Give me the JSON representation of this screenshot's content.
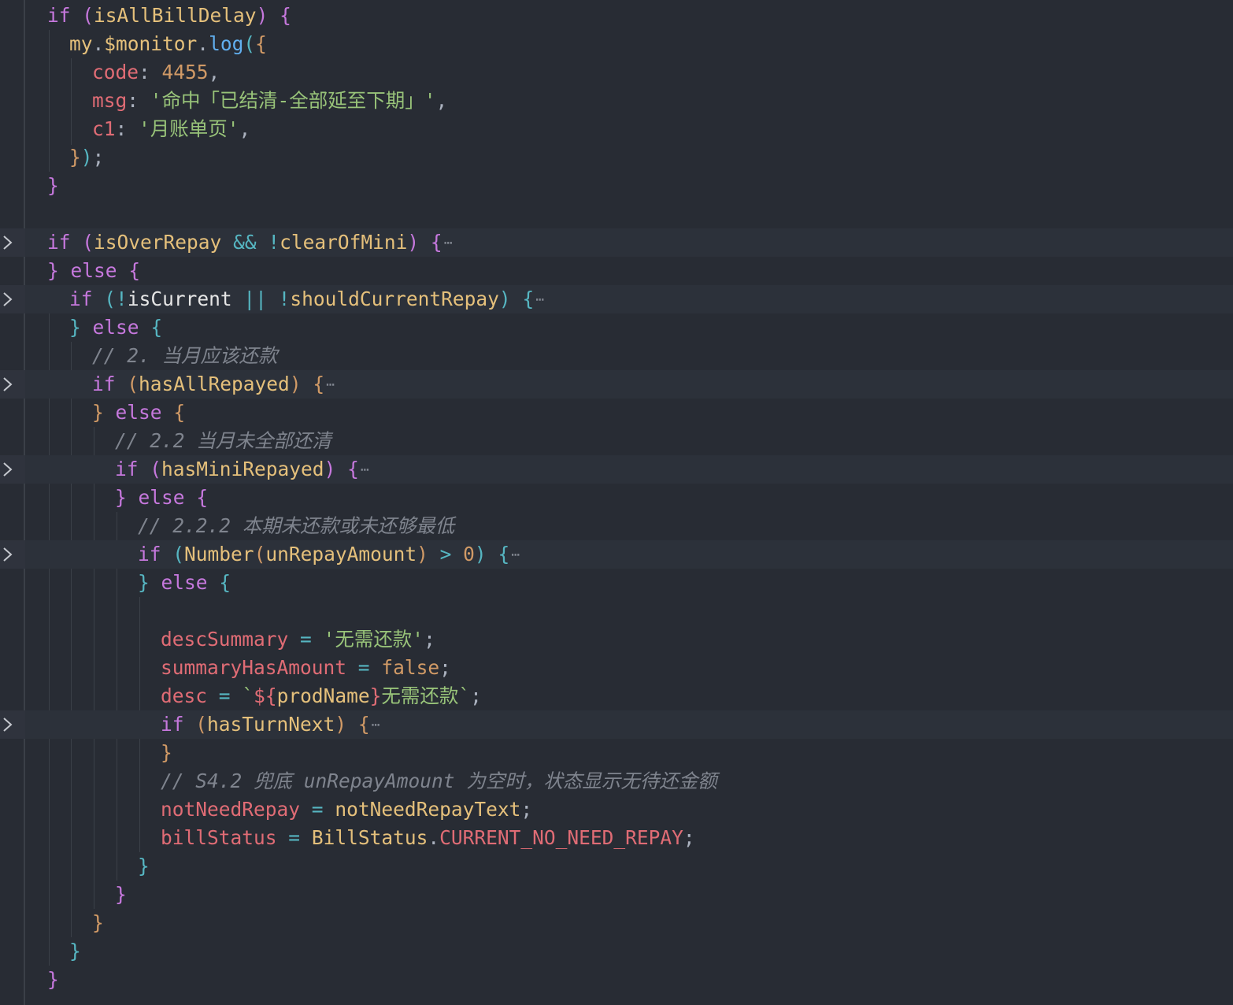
{
  "editor": {
    "language": "javascript",
    "theme_colors": {
      "background": "#282c34",
      "keyword": "#c678dd",
      "variable": "#e5c07b",
      "property": "#e06c75",
      "string": "#98c379",
      "number": "#d19a66",
      "function": "#61afef",
      "operator": "#56b6c2",
      "comment": "#7f848e"
    },
    "fold_icon": "chevron-right-icon",
    "collapsed_ellipsis": "⋯",
    "lines": [
      {
        "t1": "if",
        "t2": "(",
        "t3": "isAllBillDelay",
        "t4": ")",
        "t5": "{"
      },
      {
        "t1": "my",
        "t2": ".",
        "t3": "$monitor",
        "t4": ".",
        "t5": "log",
        "t6": "(",
        "t7": "{"
      },
      {
        "t1": "code",
        "t2": ": ",
        "t3": "4455",
        "t4": ","
      },
      {
        "t1": "msg",
        "t2": ": ",
        "t3": "'命中「已结清-全部延至下期」'",
        "t4": ","
      },
      {
        "t1": "c1",
        "t2": ": ",
        "t3": "'月账单页'",
        "t4": ","
      },
      {
        "t1": "}",
        "t2": ")",
        "t3": ";"
      },
      {
        "t1": "}"
      },
      {},
      {
        "t1": "if",
        "t2": "(",
        "t3": "isOverRepay",
        "t4": "&&",
        "t5": "!",
        "t6": "clearOfMini",
        "t7": ")",
        "t8": "{"
      },
      {
        "t1": "}",
        "t2": "else",
        "t3": "{"
      },
      {
        "t1": "if",
        "t2": "(",
        "t3": "!",
        "t4": "isCurrent",
        "t5": "||",
        "t6": "!",
        "t7": "shouldCurrentRepay",
        "t8": ")",
        "t9": "{"
      },
      {
        "t1": "}",
        "t2": "else",
        "t3": "{"
      },
      {
        "t1": "// 2. 当月应该还款"
      },
      {
        "t1": "if",
        "t2": "(",
        "t3": "hasAllRepayed",
        "t4": ")",
        "t5": "{"
      },
      {
        "t1": "}",
        "t2": "else",
        "t3": "{"
      },
      {
        "t1": "// 2.2 当月未全部还清"
      },
      {
        "t1": "if",
        "t2": "(",
        "t3": "hasMiniRepayed",
        "t4": ")",
        "t5": "{"
      },
      {
        "t1": "}",
        "t2": "else",
        "t3": "{"
      },
      {
        "t1": "// 2.2.2 本期未还款或未还够最低"
      },
      {
        "t1": "if",
        "t2": "(",
        "t3": "Number",
        "t4": "(",
        "t5": "unRepayAmount",
        "t6": ")",
        "t7": ">",
        "t8": "0",
        "t9": ")",
        "t10": "{"
      },
      {
        "t1": "}",
        "t2": "else",
        "t3": "{"
      },
      {},
      {
        "t1": "descSummary",
        "t2": "=",
        "t3": "'无需还款'",
        "t4": ";"
      },
      {
        "t1": "summaryHasAmount",
        "t2": "=",
        "t3": "false",
        "t4": ";"
      },
      {
        "t1": "desc",
        "t2": "=",
        "t3": "`",
        "t4": "${",
        "t5": "prodName",
        "t6": "}",
        "t7": "无需还款`",
        "t8": ";"
      },
      {
        "t1": "if",
        "t2": "(",
        "t3": "hasTurnNext",
        "t4": ")",
        "t5": "{"
      },
      {
        "t1": "}"
      },
      {
        "t1": "// S4.2 兜底 unRepayAmount 为空时，状态显示无待还金额"
      },
      {
        "t1": "notNeedRepay",
        "t2": "=",
        "t3": "notNeedRepayText",
        "t4": ";"
      },
      {
        "t1": "billStatus",
        "t2": "=",
        "t3": "BillStatus",
        "t4": ".",
        "t5": "CURRENT_NO_NEED_REPAY",
        "t6": ";"
      },
      {
        "t1": "}"
      },
      {
        "t1": "}"
      },
      {
        "t1": "}"
      },
      {
        "t1": "}"
      },
      {
        "t1": "}"
      }
    ]
  }
}
